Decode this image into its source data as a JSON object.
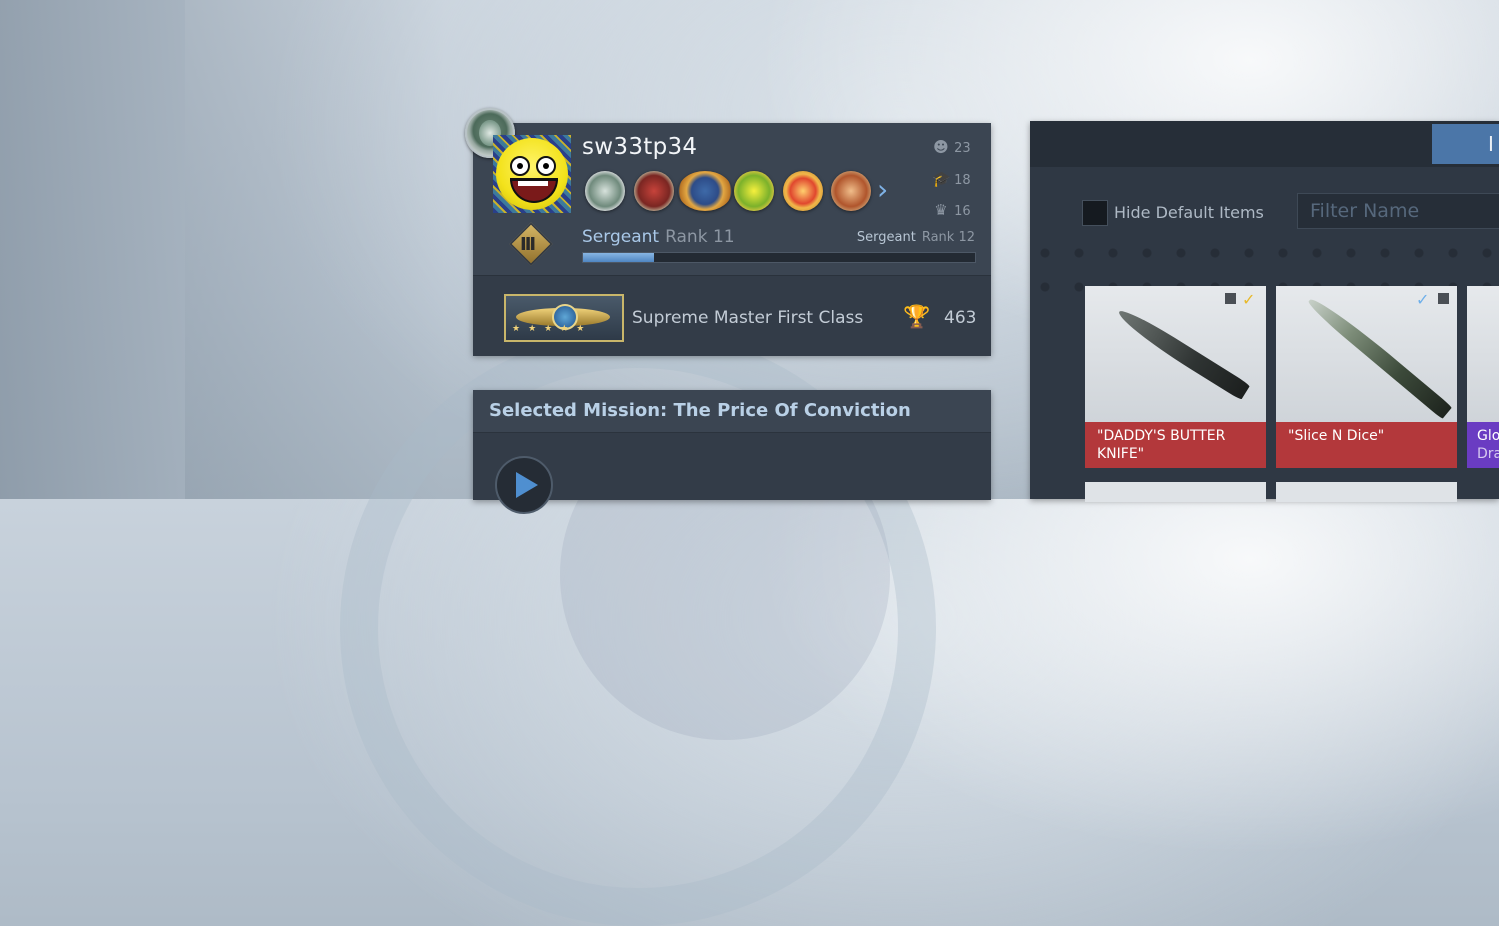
{
  "profile": {
    "username": "sw33tp34",
    "stats": [
      {
        "icon": "smile-icon",
        "value": "23"
      },
      {
        "icon": "teacher-icon",
        "value": "18"
      },
      {
        "icon": "leader-icon",
        "value": "16"
      }
    ],
    "medals": [
      "service-medal",
      "operation-medal",
      "wings-medal",
      "green-medal",
      "orange-medal",
      "bronze-medal"
    ],
    "rank_current": {
      "name": "Sergeant",
      "rank": "Rank 11"
    },
    "rank_next": {
      "name": "Sergeant",
      "rank": "Rank 12"
    },
    "xp_progress_fraction": 0.18,
    "skill_group": "Supreme Master First Class",
    "wins": "463"
  },
  "mission": {
    "title": "Selected Mission: The Price Of Conviction"
  },
  "inventory": {
    "tab_label": "I",
    "hide_default_label": "Hide Default Items",
    "filter_placeholder": "Filter Name",
    "items": [
      {
        "name": "\"DADDY'S BUTTER KNIFE\"",
        "rarity_color": "#b3383b"
      },
      {
        "name": "\"Slice N Dice\"",
        "rarity_color": "#b3383b"
      },
      {
        "name_line1": "Glo",
        "name_line2": "Dra",
        "rarity_color": "#6a3cc2"
      }
    ]
  },
  "colors": {
    "accent": "#4f8fd0",
    "rank_text": "#a9c8e8"
  }
}
